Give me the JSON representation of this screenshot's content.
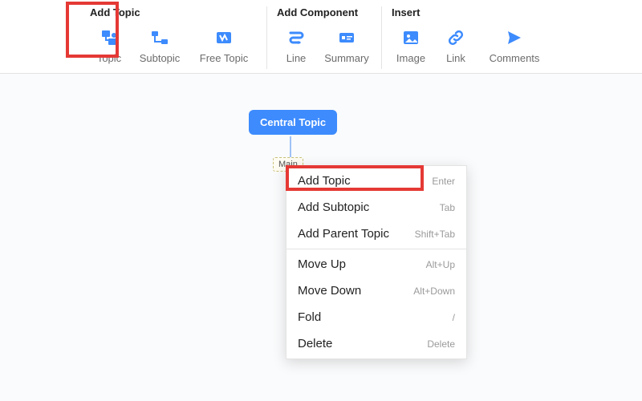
{
  "toolbar": {
    "groups": [
      {
        "title": "Add Topic",
        "items": [
          {
            "id": "topic",
            "label": "Topic"
          },
          {
            "id": "subtopic",
            "label": "Subtopic"
          },
          {
            "id": "freetopic",
            "label": "Free Topic"
          }
        ]
      },
      {
        "title": "Add Component",
        "items": [
          {
            "id": "line",
            "label": "Line"
          },
          {
            "id": "summary",
            "label": "Summary"
          }
        ]
      },
      {
        "title": "Insert",
        "items": [
          {
            "id": "image",
            "label": "Image"
          },
          {
            "id": "link",
            "label": "Link"
          },
          {
            "id": "comments",
            "label": "Comments"
          }
        ]
      }
    ]
  },
  "canvas": {
    "central_label": "Central Topic",
    "child_label": "Main"
  },
  "context_menu": {
    "items": [
      {
        "label": "Add Topic",
        "shortcut": "Enter"
      },
      {
        "label": "Add Subtopic",
        "shortcut": "Tab"
      },
      {
        "label": "Add Parent Topic",
        "shortcut": "Shift+Tab"
      },
      {
        "sep": true
      },
      {
        "label": "Move Up",
        "shortcut": "Alt+Up"
      },
      {
        "label": "Move Down",
        "shortcut": "Alt+Down"
      },
      {
        "label": "Fold",
        "shortcut": "/"
      },
      {
        "label": "Delete",
        "shortcut": "Delete"
      }
    ]
  }
}
